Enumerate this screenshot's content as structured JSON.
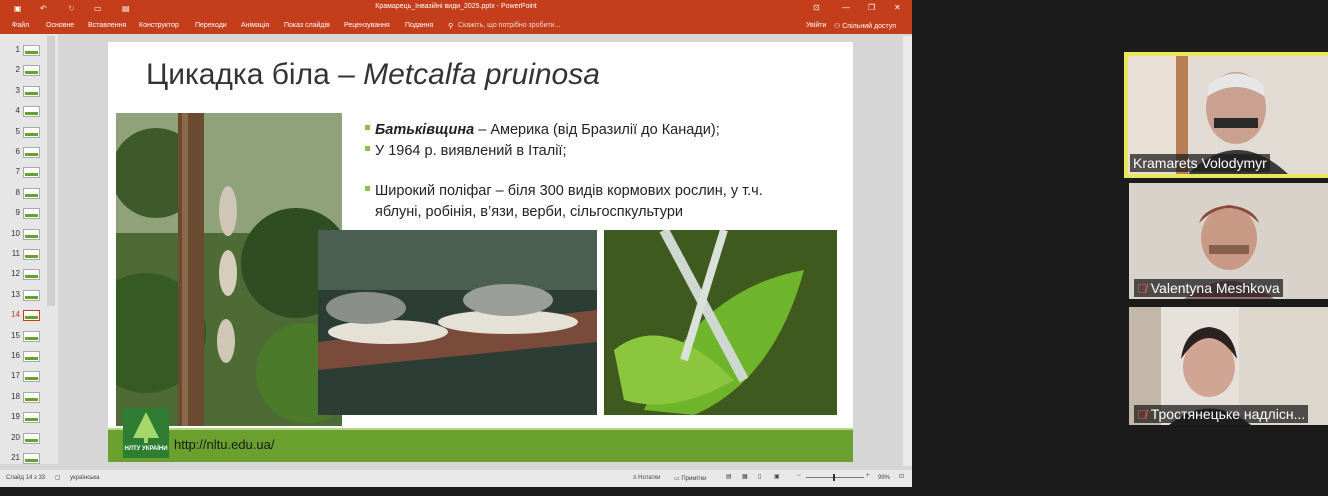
{
  "app": {
    "window_title": "Крамарець_Інвазійні види_2025.pptx - PowerPoint",
    "ribbon_tabs": [
      "Файл",
      "Основне",
      "Вставлення",
      "Конструктор",
      "Переходи",
      "Анімація",
      "Показ слайдів",
      "Рецензування",
      "Подання"
    ],
    "tell_me": "Скажіть, що потрібно зробити...",
    "signin": "Увійти",
    "share": "Спільний доступ"
  },
  "thumbnails": [
    "1",
    "2",
    "3",
    "4",
    "5",
    "6",
    "7",
    "8",
    "9",
    "10",
    "11",
    "12",
    "13",
    "14",
    "15",
    "16",
    "17",
    "18",
    "19",
    "20",
    "21"
  ],
  "active_slide": "14",
  "slide": {
    "title_plain": "Цикадка біла – ",
    "title_italic": "Metcalfa pruinosa",
    "bullets": [
      {
        "bold": "Батьківщина",
        "text": " – Америка (від Бразилії до Канади);"
      },
      {
        "bold": "",
        "text": "У 1964 р. виявлений в Італії;"
      },
      {
        "bold": "",
        "text": "Широкий поліфаг – біля 300 видів кормових рослин, у т.ч."
      }
    ],
    "bullet_cont": "яблуні, робінія, в’язи, верби, сільгоспкультури",
    "footer_url": "http://nltu.edu.ua/",
    "logo_text": "НЛТУ УКРАЇНИ"
  },
  "statusbar": {
    "slide_info": "Слайд 14 з 33",
    "language": "українська",
    "notes": "Нотатки",
    "comments": "Примітки",
    "zoom": "99%"
  },
  "participants": [
    {
      "name": "Kramarets Volodymyr",
      "muted": false
    },
    {
      "name": "Valentyna Meshkova",
      "muted": true
    },
    {
      "name": "Тростянецьке надлісн...",
      "muted": true
    }
  ],
  "colors": {
    "ppt_red": "#c43e1c",
    "accent_green": "#6aa12e",
    "active_speaker": "#e8e85a"
  }
}
